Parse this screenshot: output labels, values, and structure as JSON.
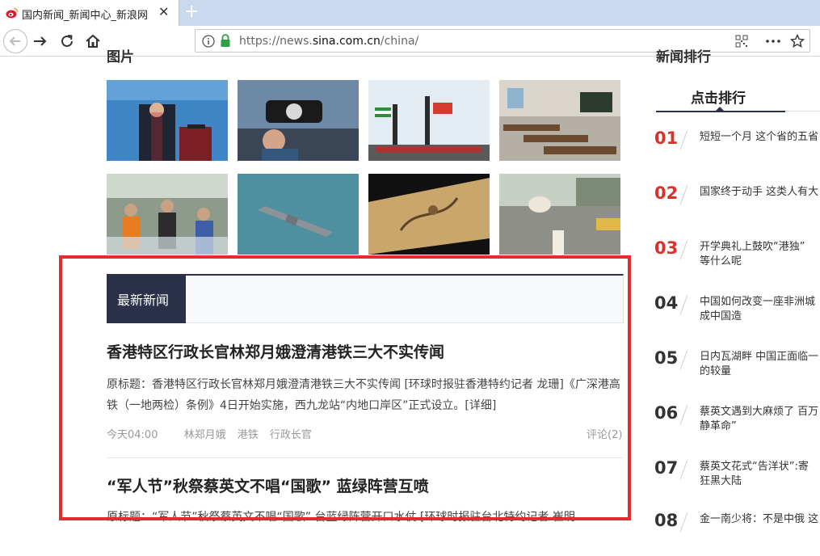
{
  "browser": {
    "tab_title": "国内新闻_新闻中心_新浪网",
    "url_prefix": "https://news.",
    "url_domain": "sina.com.cn",
    "url_path": "/china/"
  },
  "page": {
    "section_left": "图片",
    "section_right": "新闻排行",
    "rank_tab": "点击排行",
    "rankings": [
      {
        "num": "01",
        "text": "短短一个月 这个省的五省"
      },
      {
        "num": "02",
        "text": "国家终于动手 这类人有大"
      },
      {
        "num": "03",
        "text": "开学典礼上鼓吹“港独”\n等什么呢"
      },
      {
        "num": "04",
        "text": "中国如何改变一座非洲城\n成中国造"
      },
      {
        "num": "05",
        "text": "日内瓦湖畔 中国正面临一\n的较量"
      },
      {
        "num": "06",
        "text": "蔡英文遇到大麻烦了 百万\n静革命”"
      },
      {
        "num": "07",
        "text": "蔡英文花式“告洋状”:寄\n狂黑大陆"
      },
      {
        "num": "08",
        "text": "金一南少将：不是中俄 这"
      }
    ],
    "latest_tab": "最新新闻",
    "news": [
      {
        "title": "香港特区行政长官林郑月娥澄清港铁三大不实传闻",
        "summary": "原标题：香港特区行政长官林郑月娥澄清港铁三大不实传闻 [环球时报驻香港特约记者 龙珊]《广深港高铁（一地两检）条例》4日开始实施，西九龙站“内地口岸区”正式设立。[详细]",
        "time": "今天04:00",
        "tags": [
          "林郑月娥",
          "港铁",
          "行政长官"
        ],
        "comments": "评论(2)"
      },
      {
        "title": "“军人节”秋祭蔡英文不唱“国歌” 蓝绿阵营互喷",
        "summary": "原标题：“军人节”秋祭蔡英文不唱“国歌” 台蓝绿阵营开口水仗 [环球时报驻台北特约记者 崔明"
      }
    ]
  },
  "colors": {
    "accent_navy": "#2b3149",
    "rank_hot": "#d8332b",
    "highlight_box": "#e52b2b"
  }
}
